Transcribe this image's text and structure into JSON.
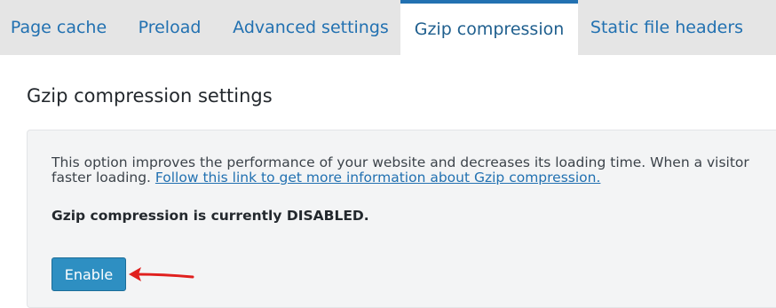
{
  "tabs": [
    {
      "label": "Page cache",
      "active": false
    },
    {
      "label": "Preload",
      "active": false
    },
    {
      "label": "Advanced settings",
      "active": false
    },
    {
      "label": "Gzip compression",
      "active": true
    },
    {
      "label": "Static file headers",
      "active": false
    }
  ],
  "section": {
    "title": "Gzip compression settings",
    "description_line1": "This option improves the performance of your website and decreases its loading time. When a visitor",
    "description_line2_prefix": "faster loading. ",
    "info_link": "Follow this link to get more information about Gzip compression.",
    "status": "Gzip compression is currently DISABLED.",
    "enable_button": "Enable"
  },
  "colors": {
    "accent": "#2271b1",
    "button": "#2e8fc2",
    "annotation_arrow": "#e0201e"
  }
}
